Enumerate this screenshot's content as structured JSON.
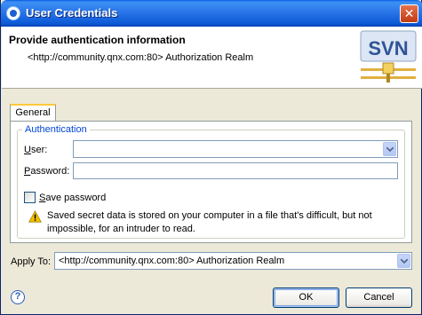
{
  "window": {
    "title": "User Credentials"
  },
  "header": {
    "title": "Provide authentication information",
    "description": "<http://community.qnx.com:80> Authorization Realm",
    "logo_text": "SVN"
  },
  "tabs": [
    {
      "label": "General",
      "selected": true
    }
  ],
  "authentication": {
    "group_label": "Authentication",
    "user_mnemonic": "U",
    "user_label_rest": "ser:",
    "user_value": "",
    "password_mnemonic": "P",
    "password_label_rest": "assword:",
    "password_value": "",
    "save_password_mnemonic": "S",
    "save_password_label_rest": "ave password",
    "save_password_checked": false,
    "warning_text": "Saved secret data is stored on your computer in a file that's difficult, but not impossible, for an intruder to read."
  },
  "apply_to": {
    "label": "Apply To:",
    "selected": "<http://community.qnx.com:80> Authorization Realm"
  },
  "buttons": {
    "ok": "OK",
    "cancel": "Cancel"
  },
  "colors": {
    "titlebar": "#0B58D6",
    "accent_label": "#0046D5",
    "tab_highlight": "#FFC83C",
    "warning": "#F2C200"
  }
}
